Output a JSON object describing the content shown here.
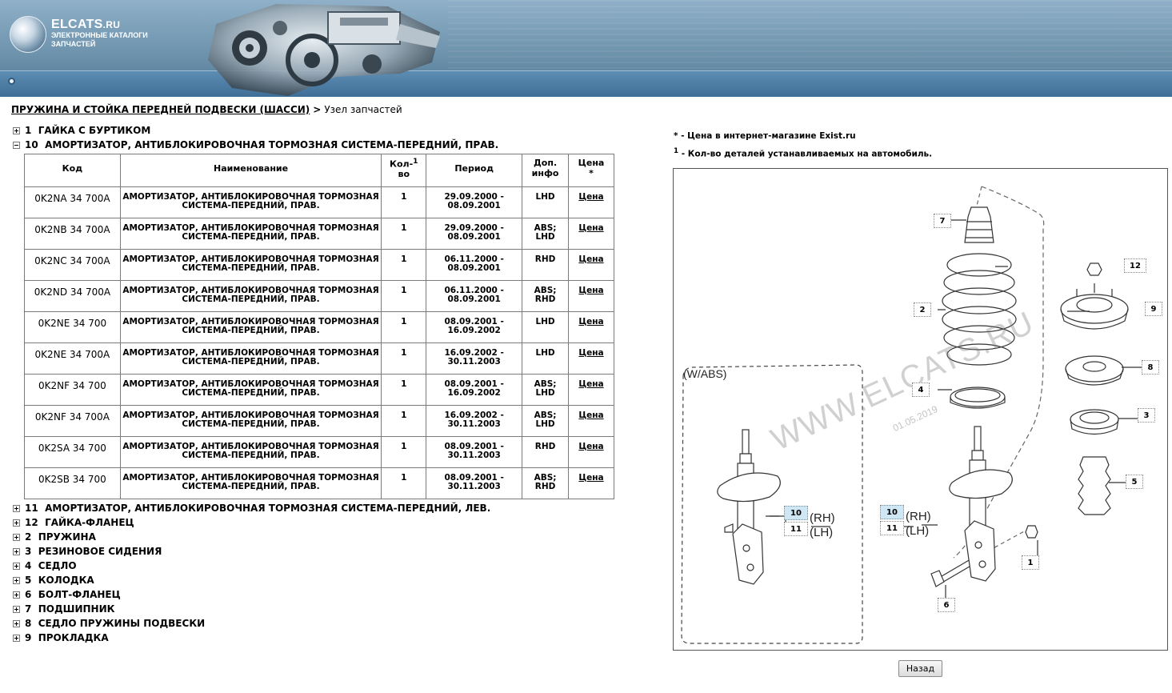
{
  "header": {
    "logo_title": "ELCATS",
    "logo_title_suffix": ".RU",
    "logo_subtitle": "ЭЛЕКТРОННЫЕ КАТАЛОГИ ЗАПЧАСТЕЙ"
  },
  "breadcrumb": {
    "link": "ПРУЖИНА И СТОЙКА ПЕРЕДНЕЙ ПОДВЕСКИ (ШАССИ)",
    "separator": ">",
    "current": "Узел запчастей"
  },
  "tree": [
    {
      "num": "1",
      "label": "ГАЙКА С БУРТИКОМ",
      "expanded": false
    },
    {
      "num": "10",
      "label": "АМОРТИЗАТОР, АНТИБЛОКИРОВОЧНАЯ ТОРМОЗНАЯ СИСТЕМА-ПЕРЕДНИЙ, ПРАВ.",
      "expanded": true
    },
    {
      "num": "11",
      "label": "АМОРТИЗАТОР, АНТИБЛОКИРОВОЧНАЯ ТОРМОЗНАЯ СИСТЕМА-ПЕРЕДНИЙ, ЛЕВ.",
      "expanded": false
    },
    {
      "num": "12",
      "label": "ГАЙКА-ФЛАНЕЦ",
      "expanded": false
    },
    {
      "num": "2",
      "label": "ПРУЖИНА",
      "expanded": false
    },
    {
      "num": "3",
      "label": "РЕЗИНОВОЕ СИДЕНИЯ",
      "expanded": false
    },
    {
      "num": "4",
      "label": "СЕДЛО",
      "expanded": false
    },
    {
      "num": "5",
      "label": "КОЛОДКА",
      "expanded": false
    },
    {
      "num": "6",
      "label": "БОЛТ-ФЛАНЕЦ",
      "expanded": false
    },
    {
      "num": "7",
      "label": "ПОДШИПНИК",
      "expanded": false
    },
    {
      "num": "8",
      "label": "СЕДЛО ПРУЖИНЫ ПОДВЕСКИ",
      "expanded": false
    },
    {
      "num": "9",
      "label": "ПРОКЛАДКА",
      "expanded": false
    }
  ],
  "table": {
    "headers": {
      "code": "Код",
      "name": "Наименование",
      "qty_line1": "Кол-",
      "qty_line2": "во",
      "qty_sup": "1",
      "period": "Период",
      "info_line1": "Доп.",
      "info_line2": "инфо",
      "price_line1": "Цена",
      "price_line2": "*"
    },
    "rows": [
      {
        "code": "0K2NA 34 700A",
        "name_line1": "АМОРТИЗАТОР, АНТИБЛОКИРОВОЧНАЯ ТОРМОЗНАЯ",
        "name_line2": "СИСТЕМА-ПЕРЕДНИЙ, ПРАВ.",
        "qty": "1",
        "period_line1": "29.09.2000 -",
        "period_line2": "08.09.2001",
        "info_line1": "LHD",
        "info_line2": "",
        "price": "Цена"
      },
      {
        "code": "0K2NB 34 700A",
        "name_line1": "АМОРТИЗАТОР, АНТИБЛОКИРОВОЧНАЯ ТОРМОЗНАЯ",
        "name_line2": "СИСТЕМА-ПЕРЕДНИЙ, ПРАВ.",
        "qty": "1",
        "period_line1": "29.09.2000 -",
        "period_line2": "08.09.2001",
        "info_line1": "ABS;",
        "info_line2": "LHD",
        "price": "Цена"
      },
      {
        "code": "0K2NC 34 700A",
        "name_line1": "АМОРТИЗАТОР, АНТИБЛОКИРОВОЧНАЯ ТОРМОЗНАЯ",
        "name_line2": "СИСТЕМА-ПЕРЕДНИЙ, ПРАВ.",
        "qty": "1",
        "period_line1": "06.11.2000 -",
        "period_line2": "08.09.2001",
        "info_line1": "RHD",
        "info_line2": "",
        "price": "Цена"
      },
      {
        "code": "0K2ND 34 700A",
        "name_line1": "АМОРТИЗАТОР, АНТИБЛОКИРОВОЧНАЯ ТОРМОЗНАЯ",
        "name_line2": "СИСТЕМА-ПЕРЕДНИЙ, ПРАВ.",
        "qty": "1",
        "period_line1": "06.11.2000 -",
        "period_line2": "08.09.2001",
        "info_line1": "ABS;",
        "info_line2": "RHD",
        "price": "Цена"
      },
      {
        "code": "0K2NE 34 700",
        "name_line1": "АМОРТИЗАТОР, АНТИБЛОКИРОВОЧНАЯ ТОРМОЗНАЯ",
        "name_line2": "СИСТЕМА-ПЕРЕДНИЙ, ПРАВ.",
        "qty": "1",
        "period_line1": "08.09.2001 -",
        "period_line2": "16.09.2002",
        "info_line1": "LHD",
        "info_line2": "",
        "price": "Цена"
      },
      {
        "code": "0K2NE 34 700A",
        "name_line1": "АМОРТИЗАТОР, АНТИБЛОКИРОВОЧНАЯ ТОРМОЗНАЯ",
        "name_line2": "СИСТЕМА-ПЕРЕДНИЙ, ПРАВ.",
        "qty": "1",
        "period_line1": "16.09.2002 -",
        "period_line2": "30.11.2003",
        "info_line1": "LHD",
        "info_line2": "",
        "price": "Цена"
      },
      {
        "code": "0K2NF 34 700",
        "name_line1": "АМОРТИЗАТОР, АНТИБЛОКИРОВОЧНАЯ ТОРМОЗНАЯ",
        "name_line2": "СИСТЕМА-ПЕРЕДНИЙ, ПРАВ.",
        "qty": "1",
        "period_line1": "08.09.2001 -",
        "period_line2": "16.09.2002",
        "info_line1": "ABS;",
        "info_line2": "LHD",
        "price": "Цена"
      },
      {
        "code": "0K2NF 34 700A",
        "name_line1": "АМОРТИЗАТОР, АНТИБЛОКИРОВОЧНАЯ ТОРМОЗНАЯ",
        "name_line2": "СИСТЕМА-ПЕРЕДНИЙ, ПРАВ.",
        "qty": "1",
        "period_line1": "16.09.2002 -",
        "period_line2": "30.11.2003",
        "info_line1": "ABS;",
        "info_line2": "LHD",
        "price": "Цена"
      },
      {
        "code": "0K2SA 34 700",
        "name_line1": "АМОРТИЗАТОР, АНТИБЛОКИРОВОЧНАЯ ТОРМОЗНАЯ",
        "name_line2": "СИСТЕМА-ПЕРЕДНИЙ, ПРАВ.",
        "qty": "1",
        "period_line1": "08.09.2001 -",
        "period_line2": "30.11.2003",
        "info_line1": "RHD",
        "info_line2": "",
        "price": "Цена"
      },
      {
        "code": "0K2SB 34 700",
        "name_line1": "АМОРТИЗАТОР, АНТИБЛОКИРОВОЧНАЯ ТОРМОЗНАЯ",
        "name_line2": "СИСТЕМА-ПЕРЕДНИЙ, ПРАВ.",
        "qty": "1",
        "period_line1": "08.09.2001 -",
        "period_line2": "30.11.2003",
        "info_line1": "ABS;",
        "info_line2": "RHD",
        "price": "Цена"
      }
    ]
  },
  "notes": {
    "price_note": "* - Цена в интернет-магазине Exist.ru",
    "qty_note_sup": "1",
    "qty_note": " - Кол-во деталей устанавливаемых на автомобиль."
  },
  "diagram": {
    "wabs_label": "(W/ABS)",
    "rh_label": "(RH)",
    "lh_label": "(LH)",
    "watermark": "WWW.ELCATS.RU",
    "watermark_date": "01.05.2019",
    "callouts": {
      "c1": "1",
      "c2": "2",
      "c3": "3",
      "c4": "4",
      "c5": "5",
      "c6": "6",
      "c7": "7",
      "c8": "8",
      "c9": "9",
      "c10a": "10",
      "c11a": "11",
      "c10b": "10",
      "c11b": "11",
      "c12": "12"
    },
    "highlight_color": "#cfe6f5"
  },
  "back_button": "Назад"
}
